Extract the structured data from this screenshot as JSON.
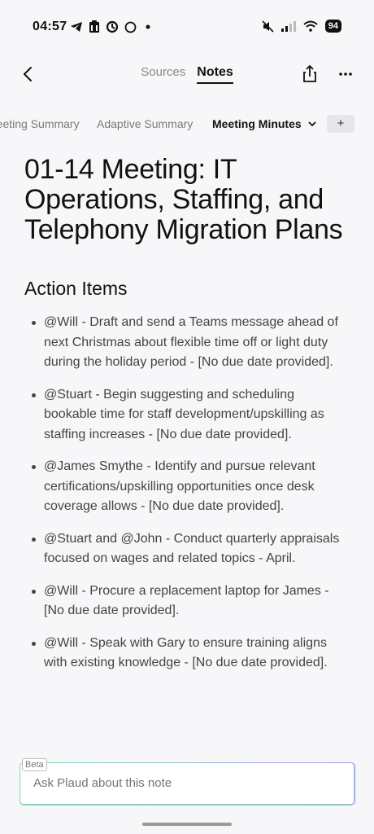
{
  "status_bar": {
    "time": "04:57",
    "battery": "94",
    "icons": [
      "telegram-icon",
      "clipboard-icon",
      "sync-icon",
      "circle-icon",
      "dot-icon",
      "mute-icon",
      "signal-icon",
      "wifi-icon",
      "battery-icon"
    ]
  },
  "nav": {
    "tabs": [
      {
        "label": "Sources",
        "active": false
      },
      {
        "label": "Notes",
        "active": true
      }
    ]
  },
  "subtabs": {
    "items": [
      {
        "label": "Meeting Summary",
        "active": false
      },
      {
        "label": "Adaptive Summary",
        "active": false
      },
      {
        "label": "Meeting Minutes",
        "active": true
      }
    ],
    "add_label": "+"
  },
  "note": {
    "title": "01-14 Meeting: IT Operations, Staffing, and Telephony Migration Plans",
    "section_heading": "Action Items",
    "action_items": [
      "@Will - Draft and send a Teams message ahead of next Christmas about flexible time off or light duty during the holiday period - [No due date provided].",
      "@Stuart - Begin suggesting and scheduling bookable time for staff development/upskilling as staffing increases - [No due date provided].",
      "@James Smythe - Identify and pursue relevant certifications/upskilling opportunities once desk coverage allows - [No due date provided].",
      "@Stuart and @John - Conduct quarterly appraisals focused on wages and related topics - April.",
      "@Will - Procure a replacement laptop for James - [No due date provided].",
      "@Will - Speak with Gary to ensure training aligns with existing knowledge - [No due date provided]."
    ]
  },
  "composer": {
    "badge": "Beta",
    "placeholder": "Ask Plaud about this note"
  }
}
